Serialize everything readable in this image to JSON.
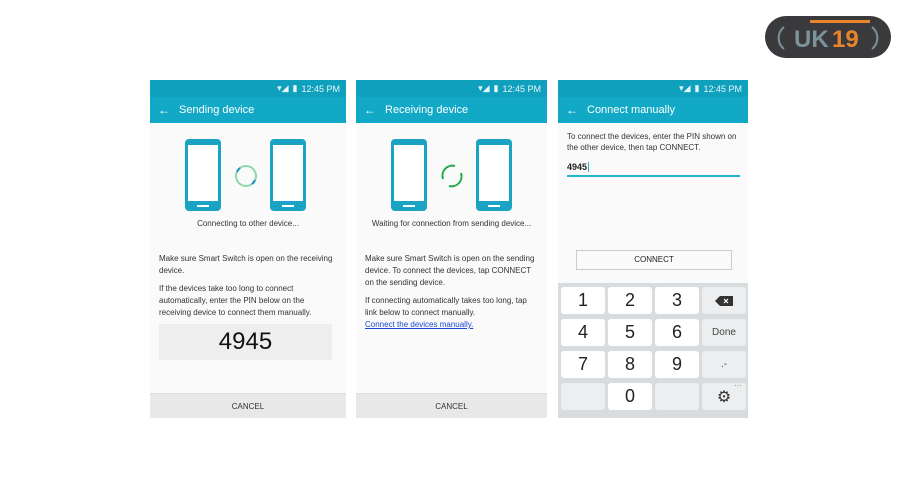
{
  "logo": {
    "text": "UK19",
    "colors": {
      "bg": "#3a3a3c",
      "letters": "#7d939b",
      "accent": "#e8852b"
    }
  },
  "colors": {
    "header": "#12a9c7",
    "status": "#0ea0bd",
    "phone": "#1aa3c3",
    "spinner": "#7fd3a0"
  },
  "status_time": "12:45 PM",
  "screens": [
    {
      "title": "Sending device",
      "caption": "Connecting to other device...",
      "p1": "Make sure Smart Switch is open on the receiving device.",
      "p2": "If the devices take too long to connect automatically, enter the PIN below on the receiving device to connect them manually.",
      "pin": "4945",
      "cancel": "CANCEL"
    },
    {
      "title": "Receiving device",
      "caption": "Waiting for connection from sending device...",
      "p1": "Make sure Smart Switch is open on the sending device. To connect the devices, tap CONNECT on the sending device.",
      "p2": "If connecting automatically takes too long, tap link below to connect manually.",
      "link": "Connect the devices manually.",
      "cancel": "CANCEL"
    },
    {
      "title": "Connect manually",
      "instructions": "To connect the devices, enter the PIN shown on the other device, then tap CONNECT.",
      "pin_value": "4945",
      "connect": "CONNECT",
      "keys": [
        "1",
        "2",
        "3",
        "backspace",
        "4",
        "5",
        "6",
        "Done",
        "7",
        "8",
        "9",
        ".-",
        "",
        "0",
        "",
        "settings"
      ]
    }
  ]
}
